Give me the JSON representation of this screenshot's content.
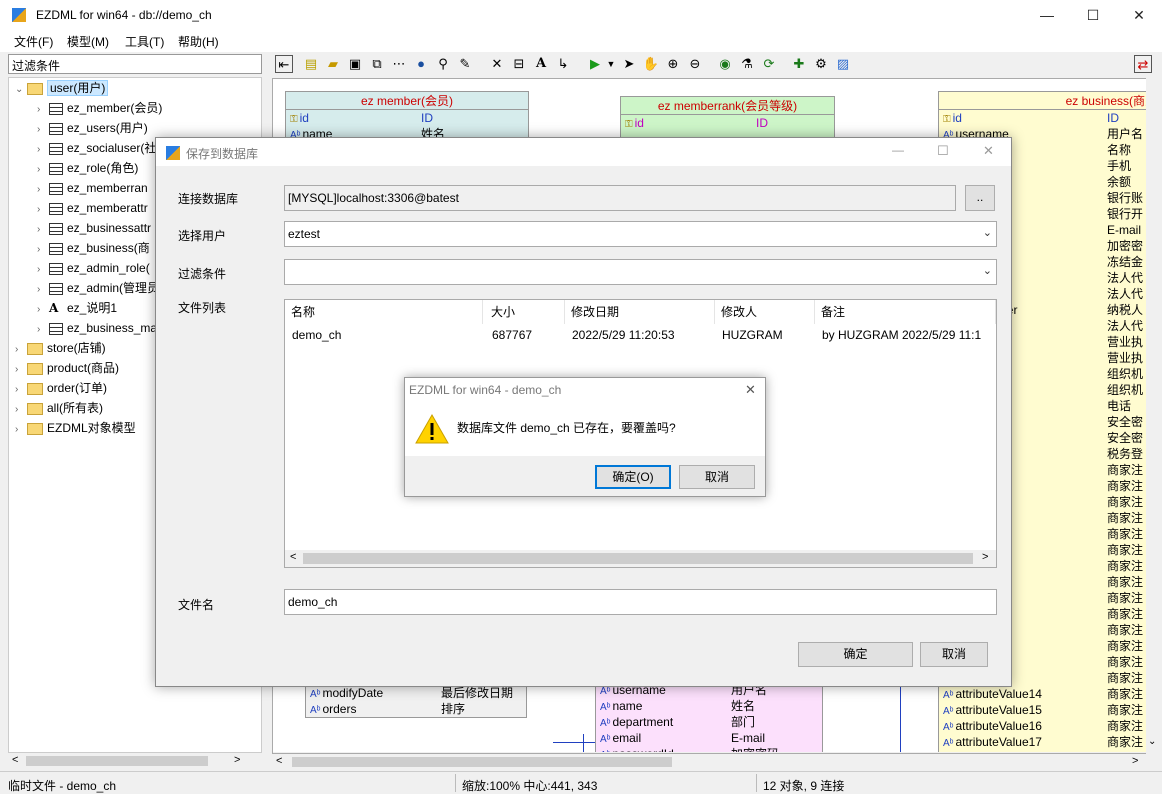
{
  "app": {
    "title": "EZDML for win64 - db://demo_ch",
    "min_glyph": "—",
    "max_glyph": "☐",
    "close_glyph": "✕"
  },
  "menu": [
    "文件(F)",
    "模型(M)",
    "工具(T)",
    "帮助(H)"
  ],
  "sidebar": {
    "filter_label": "过滤条件",
    "tree": [
      {
        "label": "user(用户)",
        "kind": "folder",
        "expanded": true,
        "selected": true
      },
      {
        "label": "ez_member(会员)",
        "kind": "table"
      },
      {
        "label": "ez_users(用户)",
        "kind": "table"
      },
      {
        "label": "ez_socialuser(社",
        "kind": "table"
      },
      {
        "label": "ez_role(角色)",
        "kind": "table"
      },
      {
        "label": "ez_memberran",
        "kind": "table"
      },
      {
        "label": "ez_memberattr",
        "kind": "table"
      },
      {
        "label": "ez_businessattr",
        "kind": "table"
      },
      {
        "label": "ez_business(商",
        "kind": "table"
      },
      {
        "label": "ez_admin_role(",
        "kind": "table"
      },
      {
        "label": "ez_admin(管理员",
        "kind": "table"
      },
      {
        "label": "ez_说明1",
        "kind": "text"
      },
      {
        "label": "ez_business_ma",
        "kind": "table"
      },
      {
        "label": "store(店铺)",
        "kind": "folder"
      },
      {
        "label": "product(商品)",
        "kind": "folder"
      },
      {
        "label": "order(订单)",
        "kind": "folder"
      },
      {
        "label": "all(所有表)",
        "kind": "folder"
      },
      {
        "label": "EZDML对象模型",
        "kind": "folder"
      }
    ]
  },
  "canvas": {
    "entities": {
      "member": {
        "title": "ez member(会员)",
        "header_color": "#d6ecec",
        "rows": [
          [
            "id",
            "ID"
          ],
          [
            "name",
            "姓名"
          ]
        ],
        "bottom_rows": [
          [
            "modifyDate",
            "最后修改日期"
          ],
          [
            "orders",
            "排序"
          ]
        ]
      },
      "memberrank": {
        "title": "ez memberrank(会员等级)",
        "header_color": "#cdf5c8",
        "rows": [
          [
            "id",
            "ID"
          ]
        ]
      },
      "business": {
        "title": "ez business(商家)",
        "header_color": "#fffcd0",
        "rows": [
          [
            "id",
            "ID"
          ],
          [
            "username",
            "用户名"
          ],
          [
            "",
            "名称"
          ],
          [
            "",
            "手机"
          ],
          [
            "",
            "余额"
          ],
          [
            "ount",
            "银行账"
          ],
          [
            "ne",
            "银行开"
          ],
          [
            "",
            "E-mail"
          ],
          [
            "Password",
            "加密密"
          ],
          [
            "nd",
            "冻结金"
          ],
          [
            "",
            "法人代"
          ],
          [
            "age",
            "法人代"
          ],
          [
            "tionNumber",
            "纳税人"
          ],
          [
            "on",
            "法人代"
          ],
          [
            "age",
            "营业执"
          ],
          [
            "mber",
            "营业执"
          ],
          [
            "tionCode",
            "组织机"
          ],
          [
            "tionImage",
            "组织机"
          ],
          [
            "",
            "电话"
          ],
          [
            "xpire",
            "安全密"
          ],
          [
            "alue",
            "安全密"
          ],
          [
            "",
            "税务登"
          ],
          [
            "Value0",
            "商家注"
          ],
          [
            "Value1",
            "商家注"
          ],
          [
            "Value2",
            "商家注"
          ],
          [
            "Value3",
            "商家注"
          ],
          [
            "Value4",
            "商家注"
          ],
          [
            "Value5",
            "商家注"
          ],
          [
            "Value6",
            "商家注"
          ],
          [
            "Value7",
            "商家注"
          ],
          [
            "Value8",
            "商家注"
          ],
          [
            "Value9",
            "商家注"
          ],
          [
            "Value10",
            "商家注"
          ],
          [
            "Value11",
            "商家注"
          ],
          [
            "Value12",
            "商家注"
          ],
          [
            "Value13",
            "商家注"
          ],
          [
            "attributeValue14",
            "商家注"
          ],
          [
            "attributeValue15",
            "商家注"
          ],
          [
            "attributeValue16",
            "商家注"
          ],
          [
            "attributeValue17",
            "商家注"
          ]
        ]
      },
      "admin": {
        "rows": [
          [
            "username",
            "用户名"
          ],
          [
            "name",
            "姓名"
          ],
          [
            "department",
            "部门"
          ],
          [
            "email",
            "E-mail"
          ],
          [
            "passwordId",
            "加密密码"
          ]
        ]
      }
    }
  },
  "status": {
    "left": "临时文件 - demo_ch",
    "middle": "缩放:100% 中心:441, 343",
    "right": "12 对象, 9 连接"
  },
  "dialog": {
    "title": "保存到数据库",
    "db_label": "连接数据库",
    "db_value": "[MYSQL]localhost:3306@batest",
    "browse_label": "..",
    "user_label": "选择用户",
    "user_value": "eztest",
    "filter_label": "过滤条件",
    "filter_value": "",
    "filelist_label": "文件列表",
    "columns": [
      "名称",
      "大小",
      "修改日期",
      "修改人",
      "备注"
    ],
    "rows": [
      {
        "name": "demo_ch",
        "size": "687767",
        "date": "2022/5/29 11:20:53",
        "user": "HUZGRAM",
        "note": "by HUZGRAM 2022/5/29 11:1"
      }
    ],
    "filename_label": "文件名",
    "filename_value": "demo_ch",
    "ok_label": "确定",
    "cancel_label": "取消"
  },
  "message": {
    "title": "EZDML for win64 - demo_ch",
    "text": "数据库文件 demo_ch 已存在，要覆盖吗?",
    "ok_label": "确定(O)",
    "cancel_label": "取消"
  }
}
